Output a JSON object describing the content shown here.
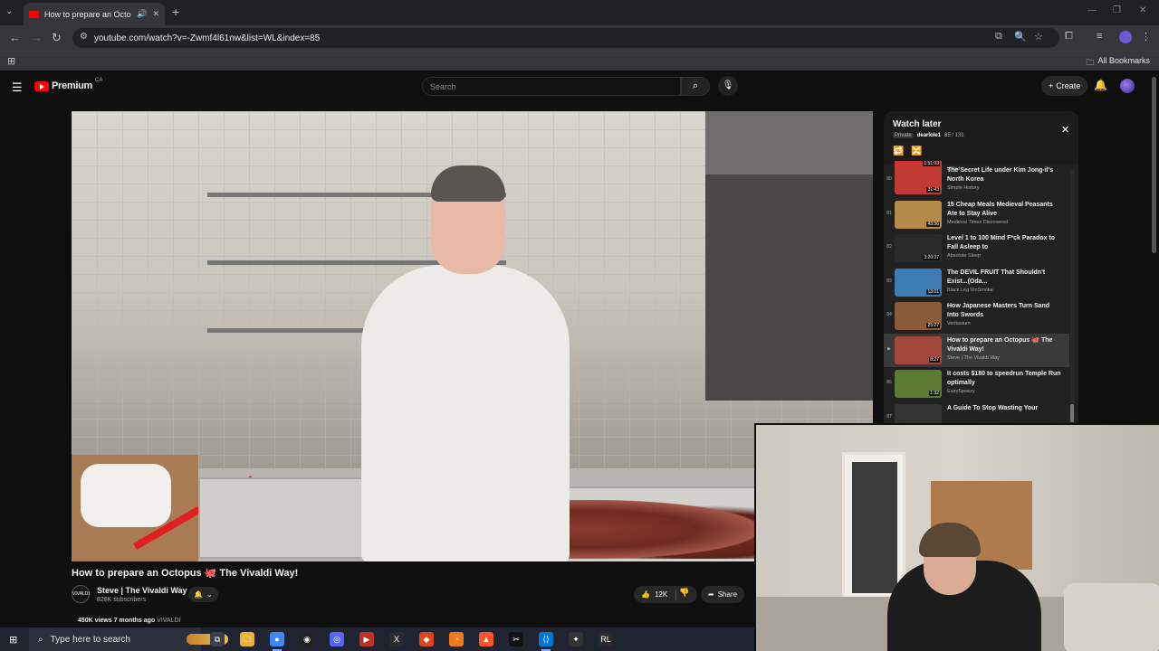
{
  "browser": {
    "tab_title": "How to prepare an Octopus",
    "url": "youtube.com/watch?v=-Zwmf4l61nw&list=WL&index=85",
    "bookmarks_label": "All Bookmarks"
  },
  "youtube": {
    "logo_text": "Premium",
    "logo_country": "CA",
    "search_placeholder": "Search",
    "create_label": "Create"
  },
  "video": {
    "title": "How to prepare an Octopus 🐙 The Vivaldi Way!",
    "channel_name": "Steve | The Vivaldi Way",
    "channel_avatar_text": "VIVALDI",
    "subscribers": "828K subscribers",
    "likes": "12K",
    "share_label": "Share",
    "views": "450K views",
    "age": "7 months ago",
    "tag": "VIVALDI"
  },
  "watch_later": {
    "title": "Watch later",
    "privacy": "Private",
    "owner": "dearlole1",
    "position": "85 / 131",
    "top_partial": {
      "duration": "1:51:03",
      "channel": "djvlad"
    },
    "items": [
      {
        "index": "80",
        "title": "The Secret Life under Kim Jong-il's North Korea",
        "channel": "Simple History",
        "duration": "31:43",
        "color": "#c23b32",
        "active": false
      },
      {
        "index": "81",
        "title": "15 Cheap Meals Medieval Peasants Ate to Stay Alive",
        "channel": "Medieval Times Discovered",
        "duration": "43:36",
        "color": "#b58a48",
        "active": false
      },
      {
        "index": "82",
        "title": "Level 1 to 100 Mind F*ck Paradox to Fall Asleep to",
        "channel": "Absolute Sleep",
        "duration": "3:20:37",
        "color": "#2a2a2a",
        "active": false
      },
      {
        "index": "83",
        "title": "The DEVIL FRUIT That Shouldn't Exist...(Oda...",
        "channel": "Black Leg VinSmoke",
        "duration": "13:01",
        "color": "#3d7bb5",
        "active": false
      },
      {
        "index": "84",
        "title": "How Japanese Masters Turn Sand Into Swords",
        "channel": "Veritasium",
        "duration": "25:27",
        "color": "#8a5a3a",
        "active": false
      },
      {
        "index": "▶",
        "title": "How to prepare an Octopus 🐙 The Vivaldi Way!",
        "channel": "Steve | The Vivaldi Way",
        "duration": "8:27",
        "color": "#a3473a",
        "active": true
      },
      {
        "index": "86",
        "title": "It costs $180 to speedrun Temple Run optimally",
        "channel": "EazySpeezy",
        "duration": "1:32",
        "color": "#5d7a32",
        "active": false
      },
      {
        "index": "87",
        "title": "A Guide To Stop Wasting Your",
        "channel": "",
        "duration": "",
        "color": "#333333",
        "active": false
      }
    ]
  },
  "taskbar": {
    "search_placeholder": "Type here to search",
    "apps": [
      "task-view",
      "file-explorer",
      "chrome",
      "obs",
      "discord",
      "video-editor",
      "app-x",
      "brave-alt",
      "blender",
      "brave",
      "capcut",
      "vscode",
      "app-dark",
      "rl"
    ]
  },
  "colors": {
    "youtube_red": "#ff0000",
    "background": "#0f0f0f",
    "panel": "#212121"
  }
}
